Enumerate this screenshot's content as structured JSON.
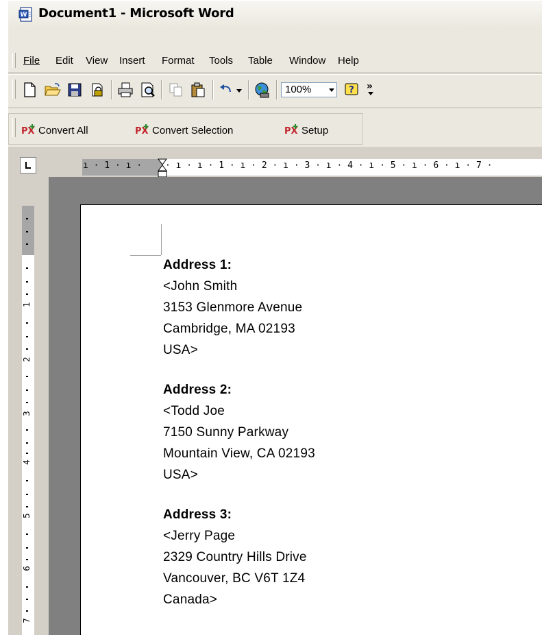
{
  "window": {
    "title": "Document1 - Microsoft Word"
  },
  "menu": {
    "items": [
      "File",
      "Edit",
      "View",
      "Insert",
      "Format",
      "Tools",
      "Table",
      "Window",
      "Help"
    ]
  },
  "toolbar": {
    "zoom": "100%",
    "overflow": "»"
  },
  "addin_toolbar": {
    "convert_all": "Convert All",
    "convert_selection": "Convert Selection",
    "setup": "Setup"
  },
  "ruler": {
    "horizontal_text": "ı · 1 · ı · ",
    "horizontal_text2": "· ı · ı · 1 · ı · 2 · ı · 3 · ı · 4 · ı · 5 · ı · 6 · ı · 7 ·",
    "vertical_numbers": [
      "1",
      "2",
      "3",
      "4",
      "5",
      "6",
      "7"
    ]
  },
  "document": {
    "addresses": [
      {
        "heading": "Address 1:",
        "lines": [
          "<John Smith",
          "3153 Glenmore Avenue",
          "Cambridge, MA 02193",
          "USA>"
        ]
      },
      {
        "heading": "Address 2:",
        "lines": [
          "<Todd Joe",
          "7150 Sunny Parkway",
          "Mountain View, CA 02193",
          "USA>"
        ]
      },
      {
        "heading": "Address 3:",
        "lines": [
          "<Jerry Page",
          "2329 Country Hills Drive",
          "Vancouver, BC V6T 1Z4",
          "Canada>"
        ]
      }
    ]
  },
  "colors": {
    "chrome": "#ebe9df",
    "workspace": "#808080",
    "page": "#ffffff"
  }
}
